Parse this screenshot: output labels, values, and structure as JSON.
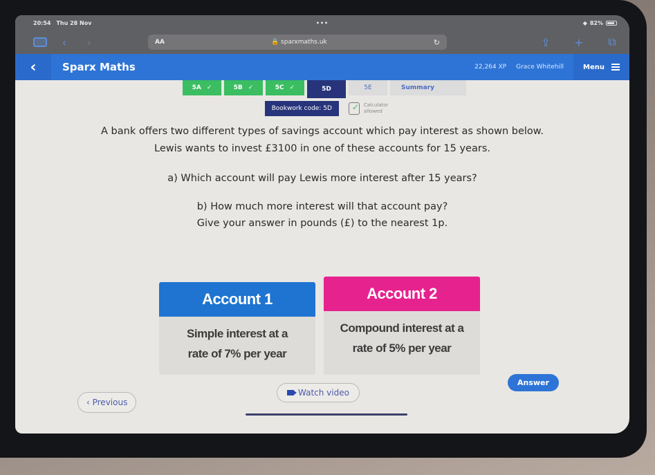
{
  "statusbar": {
    "time": "20:54",
    "date": "Thu 28 Nov",
    "dots": "•••",
    "battery": "82%"
  },
  "browser": {
    "text_size_label": "AA",
    "url": "🔒 sparxmaths.uk",
    "reload_icon": "↻",
    "back_icon": "‹",
    "forward_icon": "›",
    "share_icon": "⇪",
    "new_tab_icon": "+",
    "tabs_icon": "⧉"
  },
  "header": {
    "back_icon": "‹",
    "title": "Sparx Maths",
    "xp": "22,264 XP",
    "user": "Grace Whitehill",
    "menu_label": "Menu"
  },
  "tabs": [
    {
      "label": "5A",
      "status": "done",
      "check": "✓"
    },
    {
      "label": "5B",
      "status": "done",
      "check": "✓"
    },
    {
      "label": "5C",
      "status": "done",
      "check": "✓"
    },
    {
      "label": "5D",
      "status": "active"
    },
    {
      "label": "5E",
      "status": "todo"
    },
    {
      "label": "Summary",
      "status": "summary"
    }
  ],
  "bookwork": {
    "code_label": "Bookwork code: 5D",
    "calculator_line1": "Calculator",
    "calculator_line2": "allowed"
  },
  "question": {
    "intro": "A bank offers two different types of savings account which pay interest as shown below. Lewis wants to invest £3100 in one of these accounts for 15 years.",
    "part_a": "a) Which account will pay Lewis more interest after 15 years?",
    "part_b_line1": "b) How much more interest will that account pay?",
    "part_b_line2": "Give your answer in pounds (£) to the nearest 1p."
  },
  "accounts": [
    {
      "title": "Account 1",
      "line1": "Simple interest at a",
      "line2": "rate of 7% per year",
      "color": "#1e74d0"
    },
    {
      "title": "Account 2",
      "line1": "Compound interest at a",
      "line2": "rate of 5% per year",
      "color": "#e6228f"
    }
  ],
  "buttons": {
    "previous": "‹ Previous",
    "watch_video": "Watch video",
    "answer": "Answer"
  }
}
